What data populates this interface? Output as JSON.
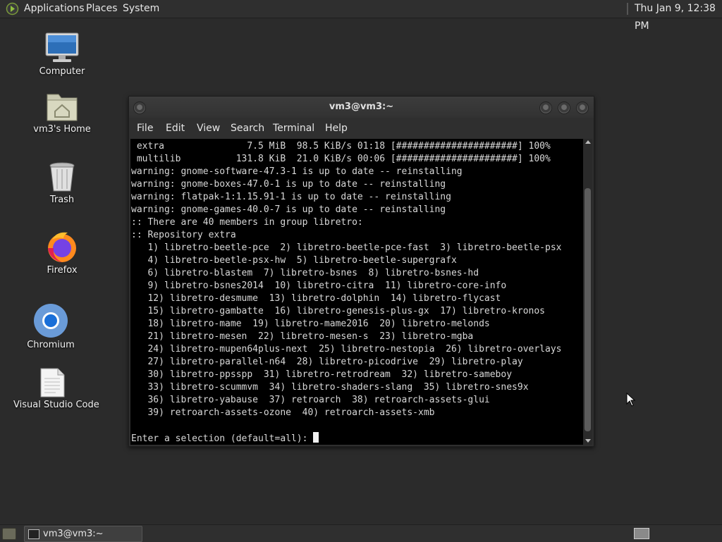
{
  "top_panel": {
    "menus": [
      "Applications",
      "Places",
      "System"
    ],
    "clock": "Thu Jan  9, 12:38 PM"
  },
  "desktop_icons": [
    {
      "label": "Computer",
      "icon": "computer-icon"
    },
    {
      "label": "vm3's Home",
      "icon": "home-folder-icon"
    },
    {
      "label": "Trash",
      "icon": "trash-icon"
    },
    {
      "label": "Firefox",
      "icon": "firefox-icon"
    },
    {
      "label": "Chromium",
      "icon": "chromium-icon"
    },
    {
      "label": "Visual Studio Code",
      "icon": "document-icon"
    }
  ],
  "terminal": {
    "title": "vm3@vm3:~",
    "menus": [
      "File",
      "Edit",
      "View",
      "Search",
      "Terminal",
      "Help"
    ],
    "lines": [
      " extra               7.5 MiB  98.5 KiB/s 01:18 [######################] 100%",
      " multilib          131.8 KiB  21.0 KiB/s 00:06 [######################] 100%",
      "warning: gnome-software-47.3-1 is up to date -- reinstalling",
      "warning: gnome-boxes-47.0-1 is up to date -- reinstalling",
      "warning: flatpak-1:1.15.91-1 is up to date -- reinstalling",
      "warning: gnome-games-40.0-7 is up to date -- reinstalling",
      ":: There are 40 members in group libretro:",
      ":: Repository extra",
      "   1) libretro-beetle-pce  2) libretro-beetle-pce-fast  3) libretro-beetle-psx",
      "   4) libretro-beetle-psx-hw  5) libretro-beetle-supergrafx",
      "   6) libretro-blastem  7) libretro-bsnes  8) libretro-bsnes-hd",
      "   9) libretro-bsnes2014  10) libretro-citra  11) libretro-core-info",
      "   12) libretro-desmume  13) libretro-dolphin  14) libretro-flycast",
      "   15) libretro-gambatte  16) libretro-genesis-plus-gx  17) libretro-kronos",
      "   18) libretro-mame  19) libretro-mame2016  20) libretro-melonds",
      "   21) libretro-mesen  22) libretro-mesen-s  23) libretro-mgba",
      "   24) libretro-mupen64plus-next  25) libretro-nestopia  26) libretro-overlays",
      "   27) libretro-parallel-n64  28) libretro-picodrive  29) libretro-play",
      "   30) libretro-ppsspp  31) libretro-retrodream  32) libretro-sameboy",
      "   33) libretro-scummvm  34) libretro-shaders-slang  35) libretro-snes9x",
      "   36) libretro-yabause  37) retroarch  38) retroarch-assets-glui",
      "   39) retroarch-assets-ozone  40) retroarch-assets-xmb",
      ""
    ],
    "prompt": "Enter a selection (default=all): "
  },
  "taskbar": {
    "window_button": "vm3@vm3:~"
  },
  "colors": {
    "desktop_bg": "#2b2b2b",
    "panel_bg": "#2f2f2f",
    "terminal_bg": "#000000",
    "terminal_fg": "#d8d8d8"
  }
}
